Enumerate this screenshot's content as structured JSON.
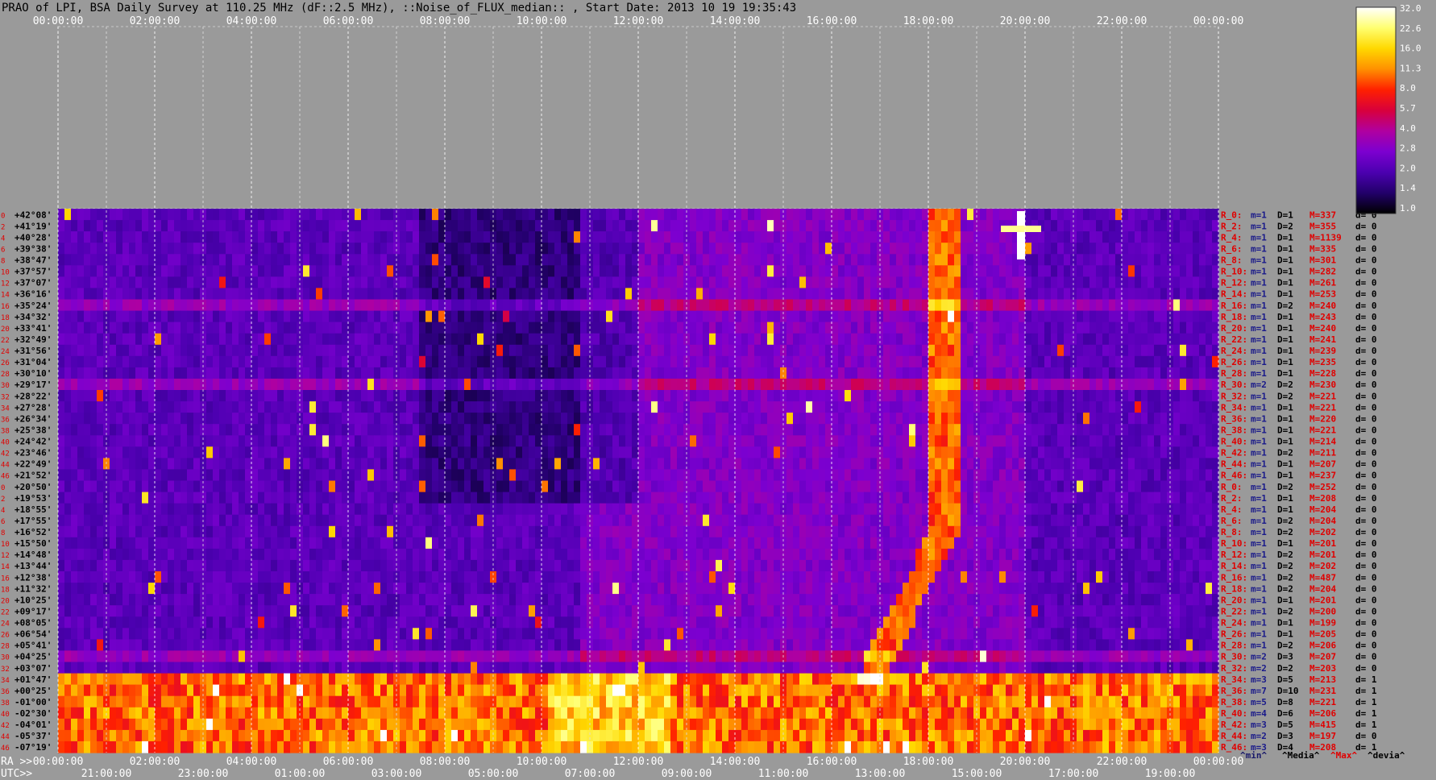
{
  "chart_data": {
    "type": "heatmap",
    "title": "PRAO of LPI, BSA Daily Survey at 110.25 MHz (dF::2.5 MHz), ::Noise_of_FLUX_median:: , Start Date: 2013 10 19 19:35:43",
    "top_time_ticks": [
      "00:00:00",
      "02:00:00",
      "04:00:00",
      "06:00:00",
      "08:00:00",
      "10:00:00",
      "12:00:00",
      "14:00:00",
      "16:00:00",
      "18:00:00",
      "20:00:00",
      "22:00:00",
      "00:00:00"
    ],
    "ra_axis_label": "RA >>",
    "ra_ticks": [
      "00:00:00",
      "02:00:00",
      "04:00:00",
      "06:00:00",
      "08:00:00",
      "10:00:00",
      "12:00:00",
      "14:00:00",
      "16:00:00",
      "18:00:00",
      "20:00:00",
      "22:00:00",
      "00:00:00"
    ],
    "utc_axis_label": "UTC>>",
    "utc_ticks": [
      "21:00:00",
      "23:00:00",
      "01:00:00",
      "03:00:00",
      "05:00:00",
      "07:00:00",
      "09:00:00",
      "11:00:00",
      "13:00:00",
      "15:00:00",
      "17:00:00",
      "19:00:00"
    ],
    "dec_labels": [
      "+42°08'",
      "+41°19'",
      "+40°28'",
      "+39°38'",
      "+38°47'",
      "+37°57'",
      "+37°07'",
      "+36°16'",
      "+35°24'",
      "+34°32'",
      "+33°41'",
      "+32°49'",
      "+31°56'",
      "+31°04'",
      "+30°10'",
      "+29°17'",
      "+28°22'",
      "+27°28'",
      "+26°34'",
      "+25°38'",
      "+24°42'",
      "+23°46'",
      "+22°49'",
      "+21°52'",
      "+20°50'",
      "+19°53'",
      "+18°55'",
      "+17°55'",
      "+16°52'",
      "+15°50'",
      "+14°48'",
      "+13°44'",
      "+12°38'",
      "+11°32'",
      "+10°25'",
      "+09°17'",
      "+08°05'",
      "+06°54'",
      "+05°41'",
      "+04°25'",
      "+03°07'",
      "+01°47'",
      "+00°25'",
      "-01°00'",
      "-02°30'",
      "-04°01'",
      "-05°37'",
      "-07°19'"
    ],
    "beam_index_labels": [
      "0",
      "2",
      "4",
      "6",
      "8",
      "10",
      "12",
      "14",
      "16",
      "18",
      "20",
      "22",
      "24",
      "26",
      "28",
      "30",
      "32",
      "34",
      "36",
      "38",
      "40",
      "42",
      "44",
      "46",
      "0",
      "2",
      "4",
      "6",
      "8",
      "10",
      "12",
      "14",
      "16",
      "18",
      "20",
      "22",
      "24",
      "26",
      "28",
      "30",
      "32",
      "34",
      "36",
      "38",
      "40",
      "42",
      "44",
      "46"
    ],
    "colorbar": {
      "ticks": [
        "32.0",
        "22.6",
        "16.0",
        "11.3",
        "8.0",
        "5.7",
        "4.0",
        "2.8",
        "2.0",
        "1.4",
        "1.0"
      ],
      "colors": [
        "#ffffff",
        "#ffff70",
        "#ffd800",
        "#ff9000",
        "#ff2000",
        "#d8003c",
        "#b000a0",
        "#7c00d0",
        "#4c00b0",
        "#22006a",
        "#000000"
      ]
    },
    "stats_header": [
      "^min^",
      "^Media^",
      "^Max^",
      "^devia^"
    ],
    "stats_header_colors": [
      "#1a1a6a",
      "#000000",
      "#e00000",
      "#000000"
    ],
    "stats": [
      {
        "r": "R_0:",
        "m": "m=1",
        "D": "D=1",
        "M": "M=337",
        "d": "d= 0"
      },
      {
        "r": "R_2:",
        "m": "m=1",
        "D": "D=2",
        "M": "M=355",
        "d": "d= 0"
      },
      {
        "r": "R_4:",
        "m": "m=1",
        "D": "D=1",
        "M": "M=1139",
        "d": "d= 0"
      },
      {
        "r": "R_6:",
        "m": "m=1",
        "D": "D=1",
        "M": "M=335",
        "d": "d= 0"
      },
      {
        "r": "R_8:",
        "m": "m=1",
        "D": "D=1",
        "M": "M=301",
        "d": "d= 0"
      },
      {
        "r": "R_10:",
        "m": "m=1",
        "D": "D=1",
        "M": "M=282",
        "d": "d= 0"
      },
      {
        "r": "R_12:",
        "m": "m=1",
        "D": "D=1",
        "M": "M=261",
        "d": "d= 0"
      },
      {
        "r": "R_14:",
        "m": "m=1",
        "D": "D=1",
        "M": "M=253",
        "d": "d= 0"
      },
      {
        "r": "R_16:",
        "m": "m=1",
        "D": "D=2",
        "M": "M=240",
        "d": "d= 0"
      },
      {
        "r": "R_18:",
        "m": "m=1",
        "D": "D=1",
        "M": "M=243",
        "d": "d= 0"
      },
      {
        "r": "R_20:",
        "m": "m=1",
        "D": "D=1",
        "M": "M=240",
        "d": "d= 0"
      },
      {
        "r": "R_22:",
        "m": "m=1",
        "D": "D=1",
        "M": "M=241",
        "d": "d= 0"
      },
      {
        "r": "R_24:",
        "m": "m=1",
        "D": "D=1",
        "M": "M=239",
        "d": "d= 0"
      },
      {
        "r": "R_26:",
        "m": "m=1",
        "D": "D=1",
        "M": "M=235",
        "d": "d= 0"
      },
      {
        "r": "R_28:",
        "m": "m=1",
        "D": "D=1",
        "M": "M=228",
        "d": "d= 0"
      },
      {
        "r": "R_30:",
        "m": "m=2",
        "D": "D=2",
        "M": "M=230",
        "d": "d= 0"
      },
      {
        "r": "R_32:",
        "m": "m=1",
        "D": "D=2",
        "M": "M=221",
        "d": "d= 0"
      },
      {
        "r": "R_34:",
        "m": "m=1",
        "D": "D=1",
        "M": "M=221",
        "d": "d= 0"
      },
      {
        "r": "R_36:",
        "m": "m=1",
        "D": "D=1",
        "M": "M=220",
        "d": "d= 0"
      },
      {
        "r": "R_38:",
        "m": "m=1",
        "D": "D=1",
        "M": "M=221",
        "d": "d= 0"
      },
      {
        "r": "R_40:",
        "m": "m=1",
        "D": "D=1",
        "M": "M=214",
        "d": "d= 0"
      },
      {
        "r": "R_42:",
        "m": "m=1",
        "D": "D=2",
        "M": "M=211",
        "d": "d= 0"
      },
      {
        "r": "R_44:",
        "m": "m=1",
        "D": "D=1",
        "M": "M=207",
        "d": "d= 0"
      },
      {
        "r": "R_46:",
        "m": "m=1",
        "D": "D=1",
        "M": "M=237",
        "d": "d= 0"
      },
      {
        "r": "R_0:",
        "m": "m=1",
        "D": "D=2",
        "M": "M=252",
        "d": "d= 0"
      },
      {
        "r": "R_2:",
        "m": "m=1",
        "D": "D=1",
        "M": "M=208",
        "d": "d= 0"
      },
      {
        "r": "R_4:",
        "m": "m=1",
        "D": "D=1",
        "M": "M=204",
        "d": "d= 0"
      },
      {
        "r": "R_6:",
        "m": "m=1",
        "D": "D=2",
        "M": "M=204",
        "d": "d= 0"
      },
      {
        "r": "R_8:",
        "m": "m=1",
        "D": "D=2",
        "M": "M=202",
        "d": "d= 0"
      },
      {
        "r": "R_10:",
        "m": "m=1",
        "D": "D=1",
        "M": "M=201",
        "d": "d= 0"
      },
      {
        "r": "R_12:",
        "m": "m=1",
        "D": "D=2",
        "M": "M=201",
        "d": "d= 0"
      },
      {
        "r": "R_14:",
        "m": "m=1",
        "D": "D=2",
        "M": "M=202",
        "d": "d= 0"
      },
      {
        "r": "R_16:",
        "m": "m=1",
        "D": "D=2",
        "M": "M=487",
        "d": "d= 0"
      },
      {
        "r": "R_18:",
        "m": "m=1",
        "D": "D=2",
        "M": "M=204",
        "d": "d= 0"
      },
      {
        "r": "R_20:",
        "m": "m=1",
        "D": "D=1",
        "M": "M=201",
        "d": "d= 0"
      },
      {
        "r": "R_22:",
        "m": "m=1",
        "D": "D=2",
        "M": "M=200",
        "d": "d= 0"
      },
      {
        "r": "R_24:",
        "m": "m=1",
        "D": "D=1",
        "M": "M=199",
        "d": "d= 0"
      },
      {
        "r": "R_26:",
        "m": "m=1",
        "D": "D=1",
        "M": "M=205",
        "d": "d= 0"
      },
      {
        "r": "R_28:",
        "m": "m=1",
        "D": "D=2",
        "M": "M=206",
        "d": "d= 0"
      },
      {
        "r": "R_30:",
        "m": "m=2",
        "D": "D=3",
        "M": "M=207",
        "d": "d= 0"
      },
      {
        "r": "R_32:",
        "m": "m=2",
        "D": "D=2",
        "M": "M=203",
        "d": "d= 0"
      },
      {
        "r": "R_34:",
        "m": "m=3",
        "D": "D=5",
        "M": "M=213",
        "d": "d= 1"
      },
      {
        "r": "R_36:",
        "m": "m=7",
        "D": "D=10",
        "M": "M=231",
        "d": "d= 1"
      },
      {
        "r": "R_38:",
        "m": "m=5",
        "D": "D=8",
        "M": "M=221",
        "d": "d= 1"
      },
      {
        "r": "R_40:",
        "m": "m=4",
        "D": "D=6",
        "M": "M=206",
        "d": "d= 1"
      },
      {
        "r": "R_42:",
        "m": "m=3",
        "D": "D=5",
        "M": "M=415",
        "d": "d= 1"
      },
      {
        "r": "R_44:",
        "m": "m=2",
        "D": "D=3",
        "M": "M=197",
        "d": "d= 0"
      },
      {
        "r": "R_46:",
        "m": "m=3",
        "D": "D=4",
        "M": "M=208",
        "d": "d= 1"
      }
    ]
  }
}
